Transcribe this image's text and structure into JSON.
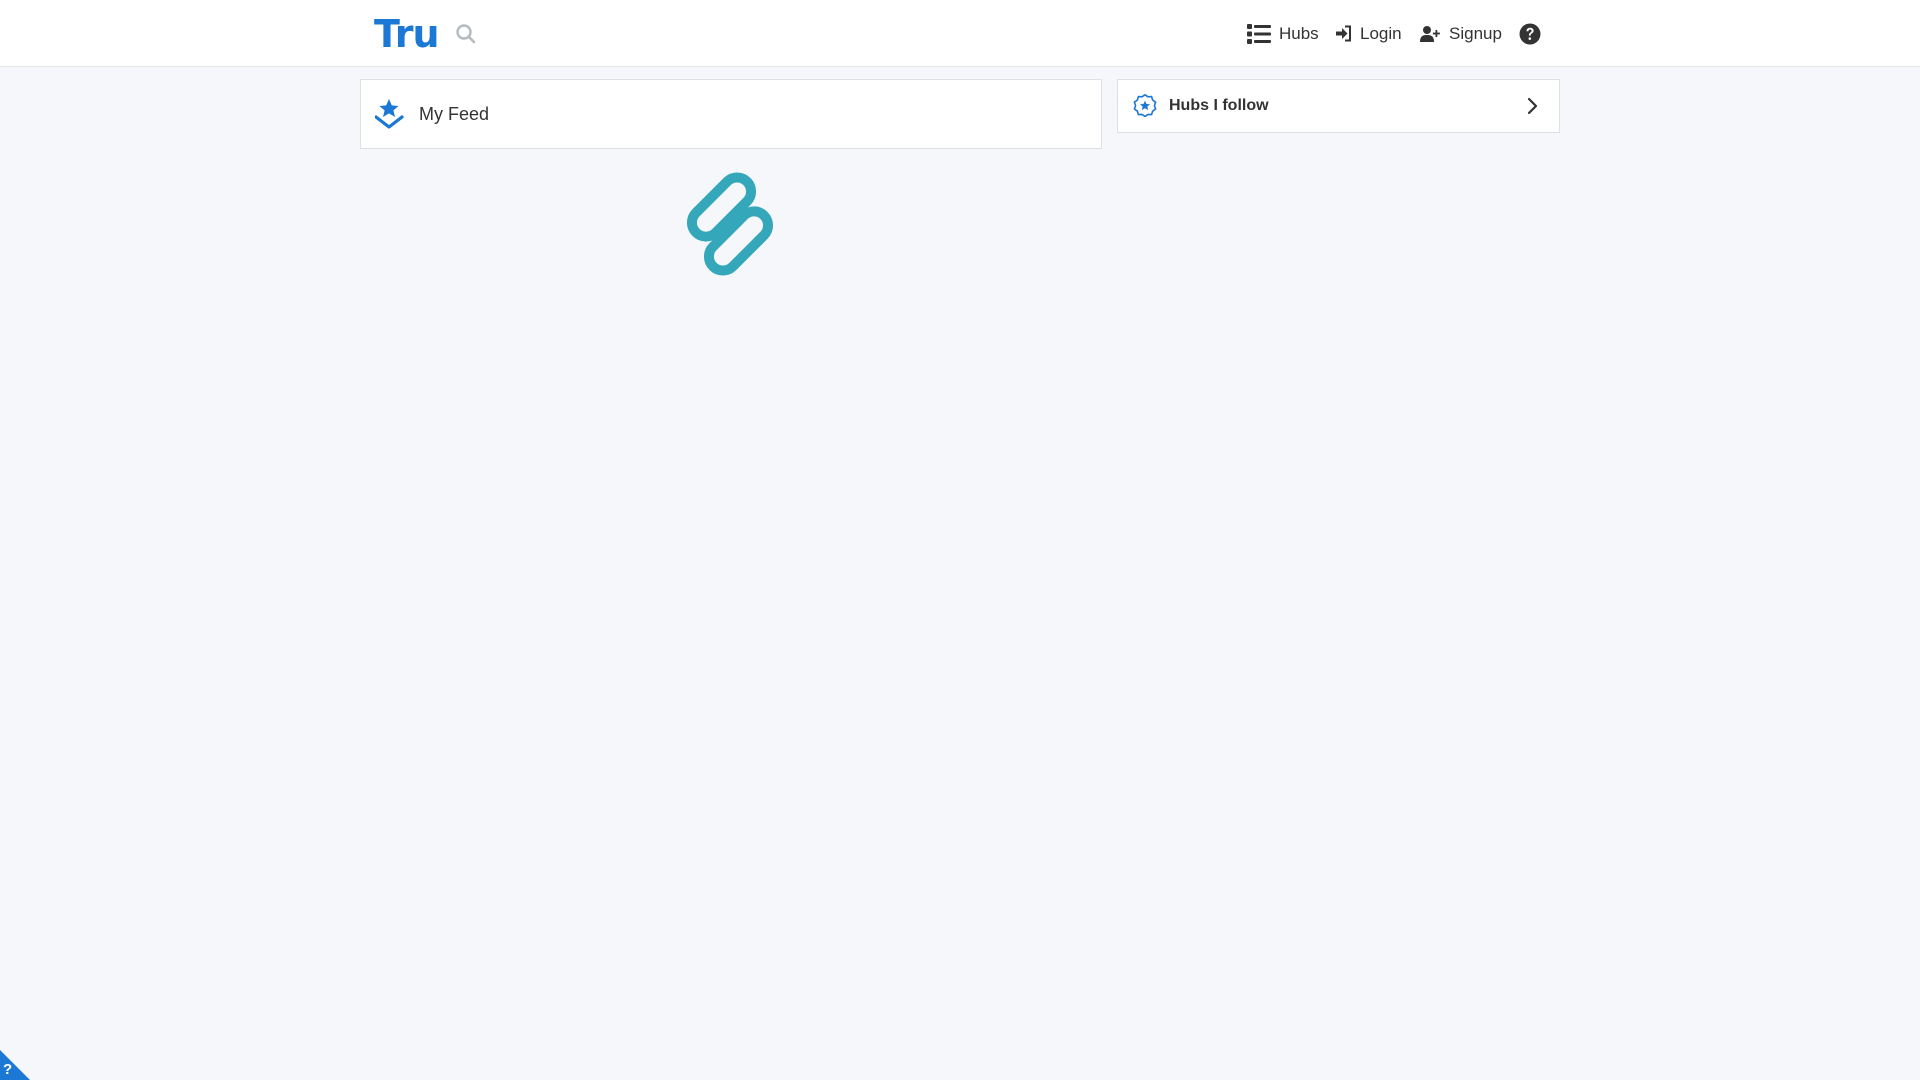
{
  "header": {
    "logo_text": "Tru",
    "search_icon": "search-icon",
    "nav": {
      "hubs_label": "Hubs",
      "login_label": "Login",
      "signup_label": "Signup",
      "help_icon": "question-circle-icon"
    }
  },
  "main": {
    "feed": {
      "title": "My Feed",
      "icon": "star-download-icon"
    },
    "loader_icon": "chain-link-spinner-icon"
  },
  "sidebar": {
    "hubs_follow": {
      "title": "Hubs I follow",
      "icon": "star-badge-icon",
      "chevron": "chevron-right-icon"
    }
  },
  "corner_help": {
    "label": "?"
  },
  "colors": {
    "brand": "#1b78d4",
    "loader": "#35a7ba",
    "background": "#f5f7fa",
    "text": "#333333"
  }
}
